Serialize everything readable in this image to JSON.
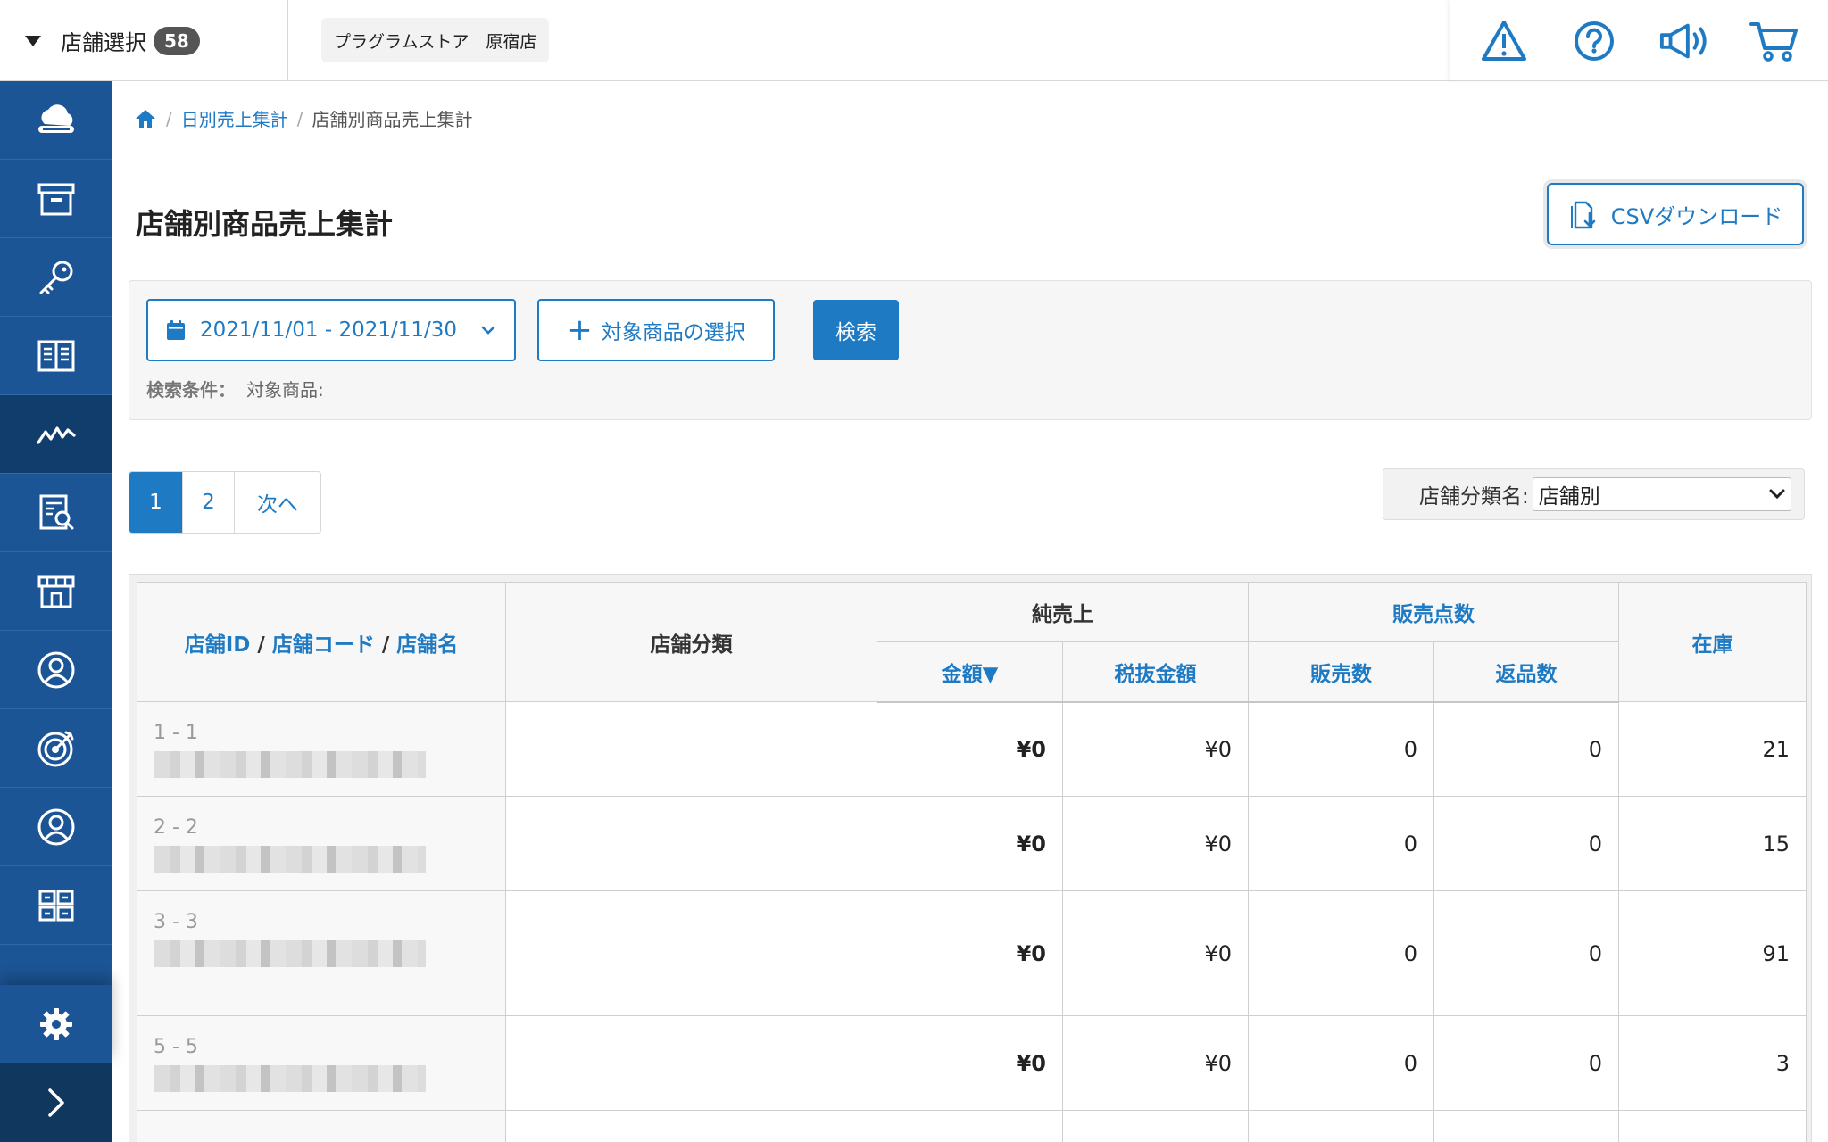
{
  "topbar": {
    "store_select_label": "店舗選択",
    "store_count": "58",
    "current_store": "プラグラムストア　原宿店"
  },
  "breadcrumb": {
    "parent": "日別売上集計",
    "current": "店舗別商品売上集計"
  },
  "page": {
    "title": "店舗別商品売上集計",
    "csv_button": "CSVダウンロード"
  },
  "filter": {
    "date_range": "2021/11/01 - 2021/11/30",
    "product_button": "対象商品の選択",
    "search_button": "検索",
    "conditions_label": "検索条件：",
    "conditions_value": "対象商品:"
  },
  "pager": {
    "pages": [
      "1",
      "2"
    ],
    "next": "次へ"
  },
  "category": {
    "label": "店舗分類名:",
    "selected": "店舗別"
  },
  "table": {
    "headers": {
      "store_id": "店舗ID",
      "store_code": "店舗コード",
      "store_name": "店舗名",
      "store_category": "店舗分類",
      "net_sales": "純売上",
      "amount": "金額▼",
      "amount_ex_tax": "税抜金額",
      "units": "販売点数",
      "sold": "販売数",
      "returned": "返品数",
      "stock": "在庫"
    },
    "rows": [
      {
        "id": "1 - 1",
        "amount": "¥0",
        "amount_ex_tax": "¥0",
        "sold": "0",
        "returned": "0",
        "stock": "21"
      },
      {
        "id": "2 - 2",
        "amount": "¥0",
        "amount_ex_tax": "¥0",
        "sold": "0",
        "returned": "0",
        "stock": "15"
      },
      {
        "id": "3 - 3",
        "amount": "¥0",
        "amount_ex_tax": "¥0",
        "sold": "0",
        "returned": "0",
        "stock": "91"
      },
      {
        "id": "5 - 5",
        "amount": "¥0",
        "amount_ex_tax": "¥0",
        "sold": "0",
        "returned": "0",
        "stock": "3"
      }
    ]
  },
  "colors": {
    "sidebar": "#1c5596",
    "sidebar_active": "#113d6d",
    "accent": "#1f7ac4"
  }
}
